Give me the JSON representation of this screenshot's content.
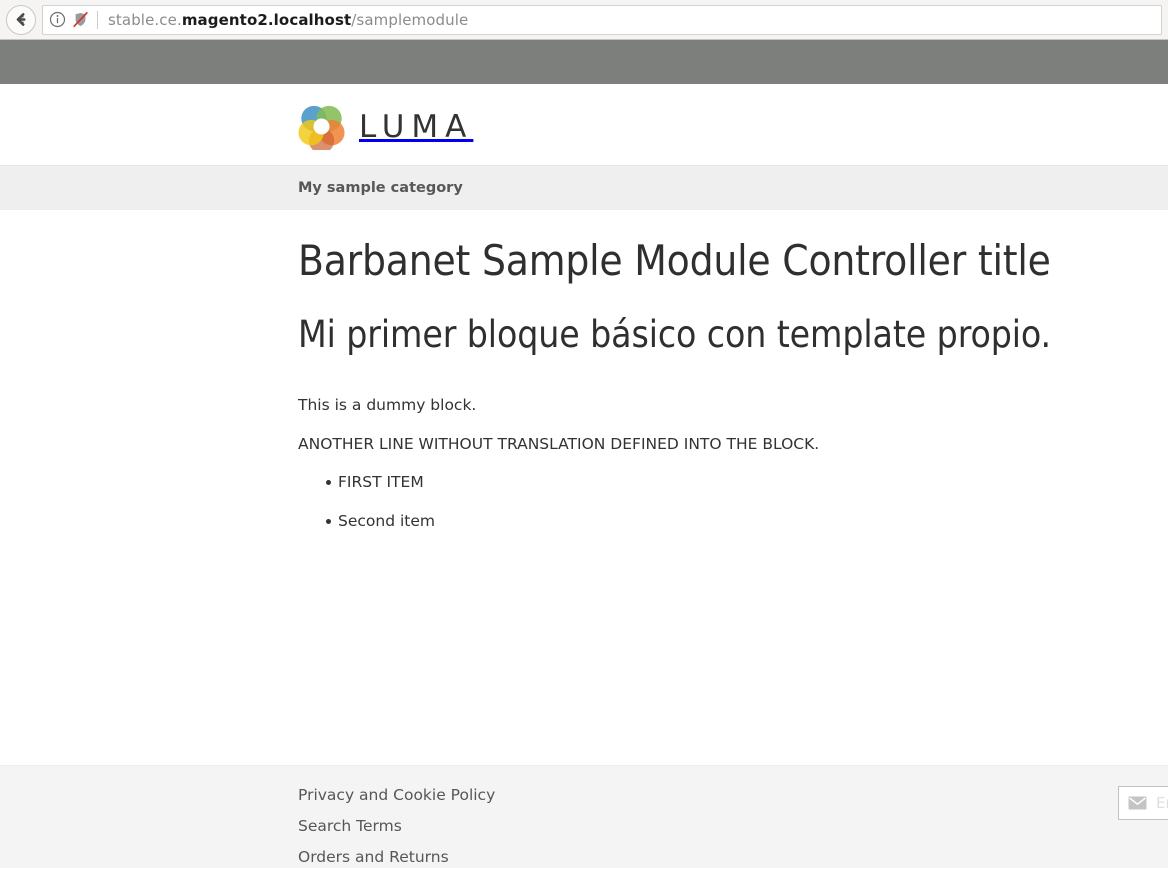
{
  "browser": {
    "back_label": "Back",
    "back_icon": "arrow-left-icon",
    "info_icon": "info-circle-icon",
    "security_icon": "shield-crossed-out-icon",
    "url": {
      "prefix": "stable.ce.",
      "host": "magento2.localhost",
      "path": "/samplemodule",
      "full": "stable.ce.magento2.localhost/samplemodule"
    }
  },
  "site": {
    "logo_text": "LUMA",
    "logo_icon": "luma-flower-logo",
    "logo_colors": {
      "blue": "#4e9ac9",
      "green": "#7ab648",
      "orange": "#ee7623",
      "yellow": "#f1c400",
      "olive": "#5a8a3c",
      "brown": "#8c5b2f",
      "teal": "#3f7f93"
    }
  },
  "category": {
    "title": "My sample category"
  },
  "main": {
    "page_title": "Barbanet Sample Module Controller title",
    "block_title": "Mi primer bloque básico con template propio.",
    "paragraphs": [
      "This is a dummy block.",
      "ANOTHER LINE WITHOUT TRANSLATION DEFINED INTO THE BLOCK."
    ],
    "list_items": [
      "FIRST ITEM",
      "Second item"
    ]
  },
  "footer": {
    "links": [
      "Privacy and Cookie Policy",
      "Search Terms",
      "Orders and Returns"
    ],
    "newsletter": {
      "icon": "envelope-icon",
      "placeholder": "Enter your email address",
      "value": ""
    }
  },
  "colors": {
    "gray_band": "#7d7f7d",
    "category_bg": "#efefef",
    "footer_bg": "#f4f4f4",
    "text": "#333333"
  }
}
